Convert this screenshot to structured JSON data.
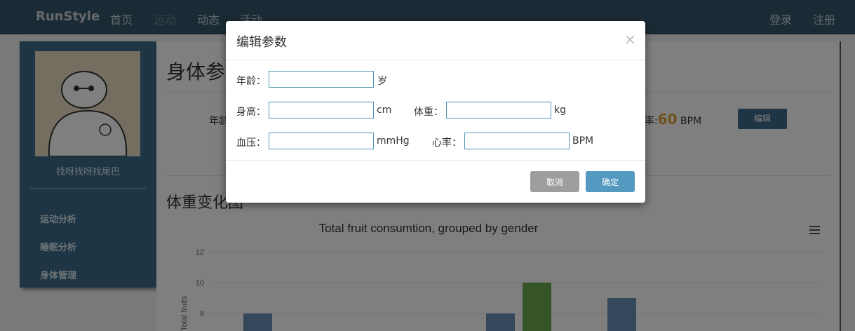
{
  "navbar": {
    "brand": "RunStyle",
    "items": [
      {
        "label": "首页"
      },
      {
        "label": "运动"
      },
      {
        "label": "动态"
      },
      {
        "label": "活动"
      }
    ],
    "login": "登录",
    "register": "注册"
  },
  "sidebar": {
    "username": "找呀找呀找尾巴",
    "items": [
      {
        "label": "运动分析"
      },
      {
        "label": "睡眠分析"
      },
      {
        "label": "身体管理"
      }
    ]
  },
  "main": {
    "page_title": "身体参数",
    "params": {
      "age_label_partial": "年龄",
      "heart_rate_label_partial": "率:",
      "heart_rate_value": "60",
      "heart_rate_unit": "BPM"
    },
    "edit_button": "编辑",
    "section_title": "体重变化图"
  },
  "chart_data": {
    "type": "bar",
    "title": "Total fruit consumtion, grouped by gender",
    "ylabel": "Total fruits",
    "y_ticks": [
      "12",
      "10",
      "8"
    ],
    "ylim": [
      0,
      12
    ],
    "series": [
      {
        "color": "#6a8fb6",
        "values": [
          8,
          8,
          9
        ]
      },
      {
        "color": "#6aa84f",
        "values": [
          10
        ]
      }
    ]
  },
  "modal": {
    "title": "编辑参数",
    "close": "×",
    "fields": {
      "age": {
        "label": "年龄：",
        "unit": "岁",
        "value": ""
      },
      "height": {
        "label": "身高：",
        "unit": "cm",
        "value": ""
      },
      "weight": {
        "label": "体重：",
        "unit": "kg",
        "value": ""
      },
      "blood_pressure": {
        "label": "血压：",
        "unit": "mmHg",
        "value": ""
      },
      "heart_rate": {
        "label": "心率：",
        "unit": "BPM",
        "value": ""
      }
    },
    "cancel": "取消",
    "confirm": "确定"
  }
}
